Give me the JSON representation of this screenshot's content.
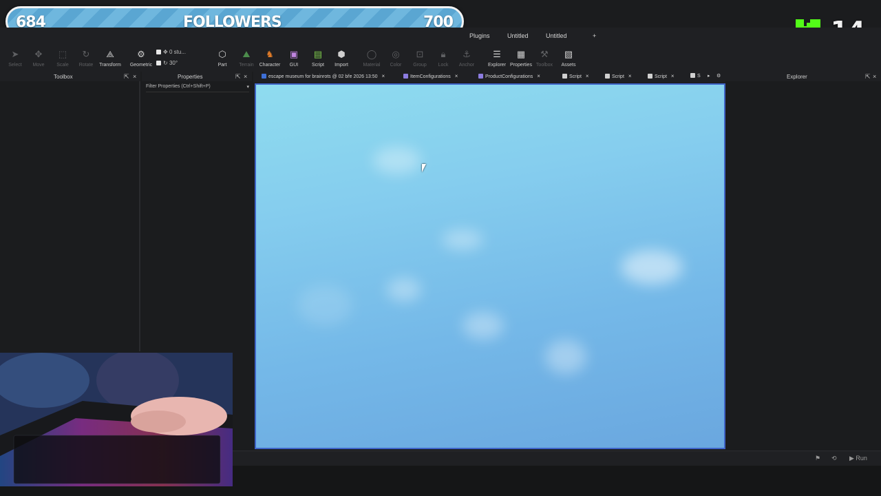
{
  "overlay": {
    "followers_current": "684",
    "followers_label": "FOLLOWERS",
    "followers_goal": "700",
    "kick_count": "14"
  },
  "menu": {
    "items": [
      "Plugins",
      "Untitled",
      "Untitled",
      "+"
    ]
  },
  "ribbon": {
    "select": "Select",
    "move": "Move",
    "scale": "Scale",
    "rotate": "Rotate",
    "transform": "Transform",
    "geometric": "Geometric",
    "move_step": "0 stu...",
    "rotate_step": "30°",
    "part": "Part",
    "terrain": "Terrain",
    "character": "Character",
    "gui": "GUI",
    "script": "Script",
    "import": "Import",
    "material": "Material",
    "color": "Color",
    "group": "Group",
    "lock": "Lock",
    "anchor": "Anchor",
    "explorer": "Explorer",
    "properties": "Properties",
    "toolbox": "Toolbox",
    "assets": "Assets"
  },
  "panels": {
    "toolbox_title": "Toolbox",
    "properties_title": "Properties",
    "filter_placeholder": "Filter Properties (Ctrl+Shift+P)",
    "explorer_title": "Explorer"
  },
  "tabs": [
    {
      "label": "escape museum for brainrots @ 02 bře 2026 13:50",
      "icon": "place-icon"
    },
    {
      "label": "ItemConfigurations",
      "icon": "module-script-icon"
    },
    {
      "label": "ProductConfigurations",
      "icon": "module-script-icon"
    },
    {
      "label": "Script",
      "icon": "script-icon"
    },
    {
      "label": "Script",
      "icon": "script-icon"
    },
    {
      "label": "Script",
      "icon": "script-icon"
    },
    {
      "label": "S",
      "icon": "script-icon"
    }
  ],
  "bottombar": {
    "run_label": "Run"
  },
  "colors": {
    "sky_top": "#8fdcef",
    "sky_bottom": "#6aa7df",
    "viewport_border": "#3e63c7",
    "kick_green": "#53fc18"
  }
}
